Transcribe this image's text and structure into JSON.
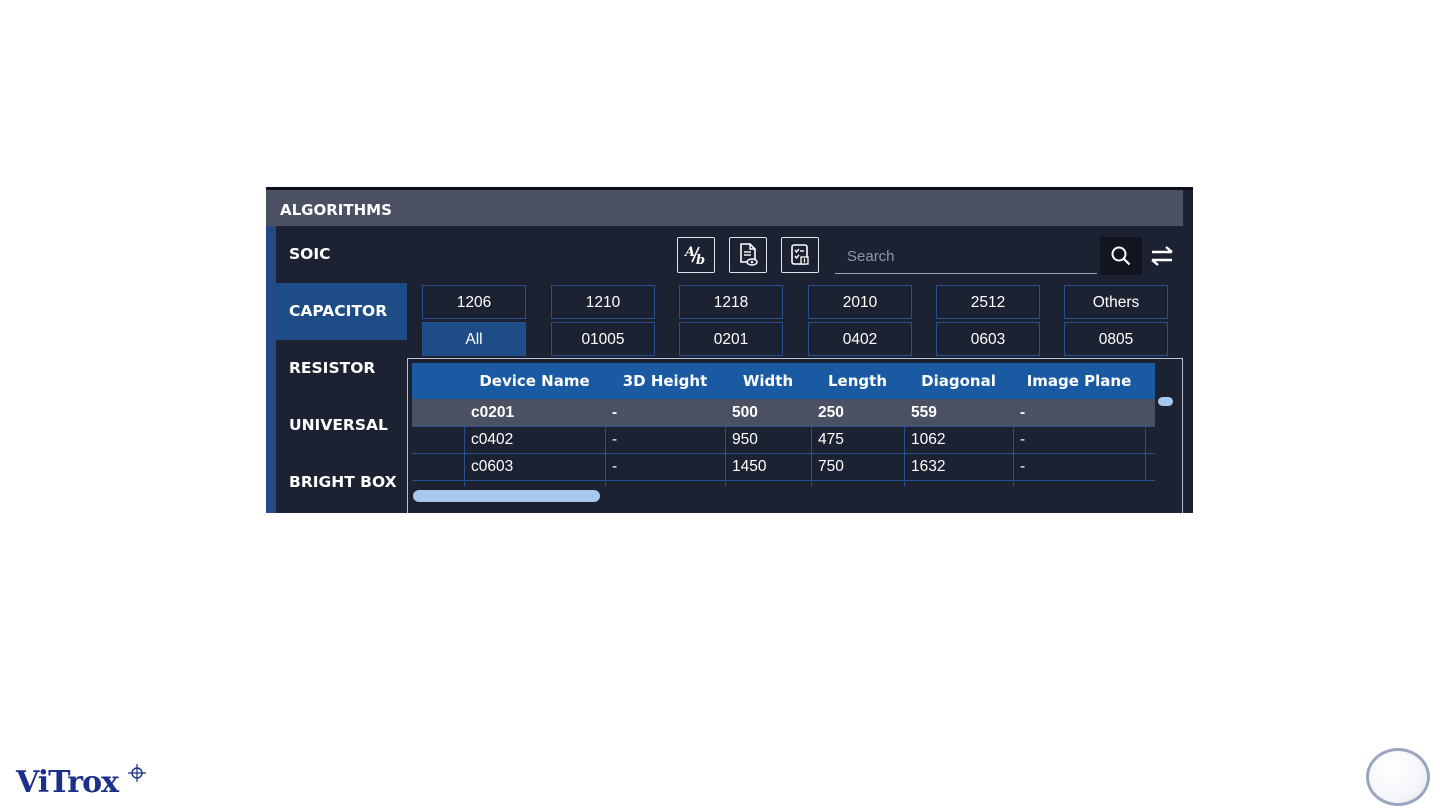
{
  "panel": {
    "title": "ALGORITHMS",
    "sidebar": [
      {
        "label": "SOIC",
        "active": false
      },
      {
        "label": "CAPACITOR",
        "active": true
      },
      {
        "label": "RESISTOR",
        "active": false
      },
      {
        "label": "UNIVERSAL",
        "active": false
      },
      {
        "label": "BRIGHT BOX",
        "active": false
      }
    ]
  },
  "toolbar": {
    "icons": [
      "rename-icon",
      "document-preview-icon",
      "checklist-export-icon"
    ],
    "search_placeholder": "Search",
    "search_icon": "search-icon",
    "swap_icon": "swap-arrows-icon"
  },
  "filters": {
    "row1": [
      "1206",
      "1210",
      "1218",
      "2010",
      "2512",
      "Others"
    ],
    "row2": [
      "All",
      "01005",
      "0201",
      "0402",
      "0603",
      "0805"
    ],
    "selected": "All"
  },
  "table": {
    "columns": [
      "Device Name",
      "3D Height",
      "Width",
      "Length",
      "Diagonal",
      "Image Plane"
    ],
    "rows": [
      [
        "c0201",
        "-",
        "500",
        "250",
        "559",
        "-"
      ],
      [
        "c0402",
        "-",
        "950",
        "475",
        "1062",
        "-"
      ],
      [
        "c0603",
        "-",
        "1450",
        "750",
        "1632",
        "-"
      ]
    ],
    "selected_row": 0
  },
  "branding": {
    "logo_text": "ViTrox",
    "logo_color": "#1c2f8a"
  },
  "colors": {
    "panel_bg": "#1d2232",
    "header_bg": "#4b5062",
    "accent_blue": "#1e4c86",
    "table_header": "#1a5aa3",
    "scroll_thumb": "#a8c8f0"
  }
}
